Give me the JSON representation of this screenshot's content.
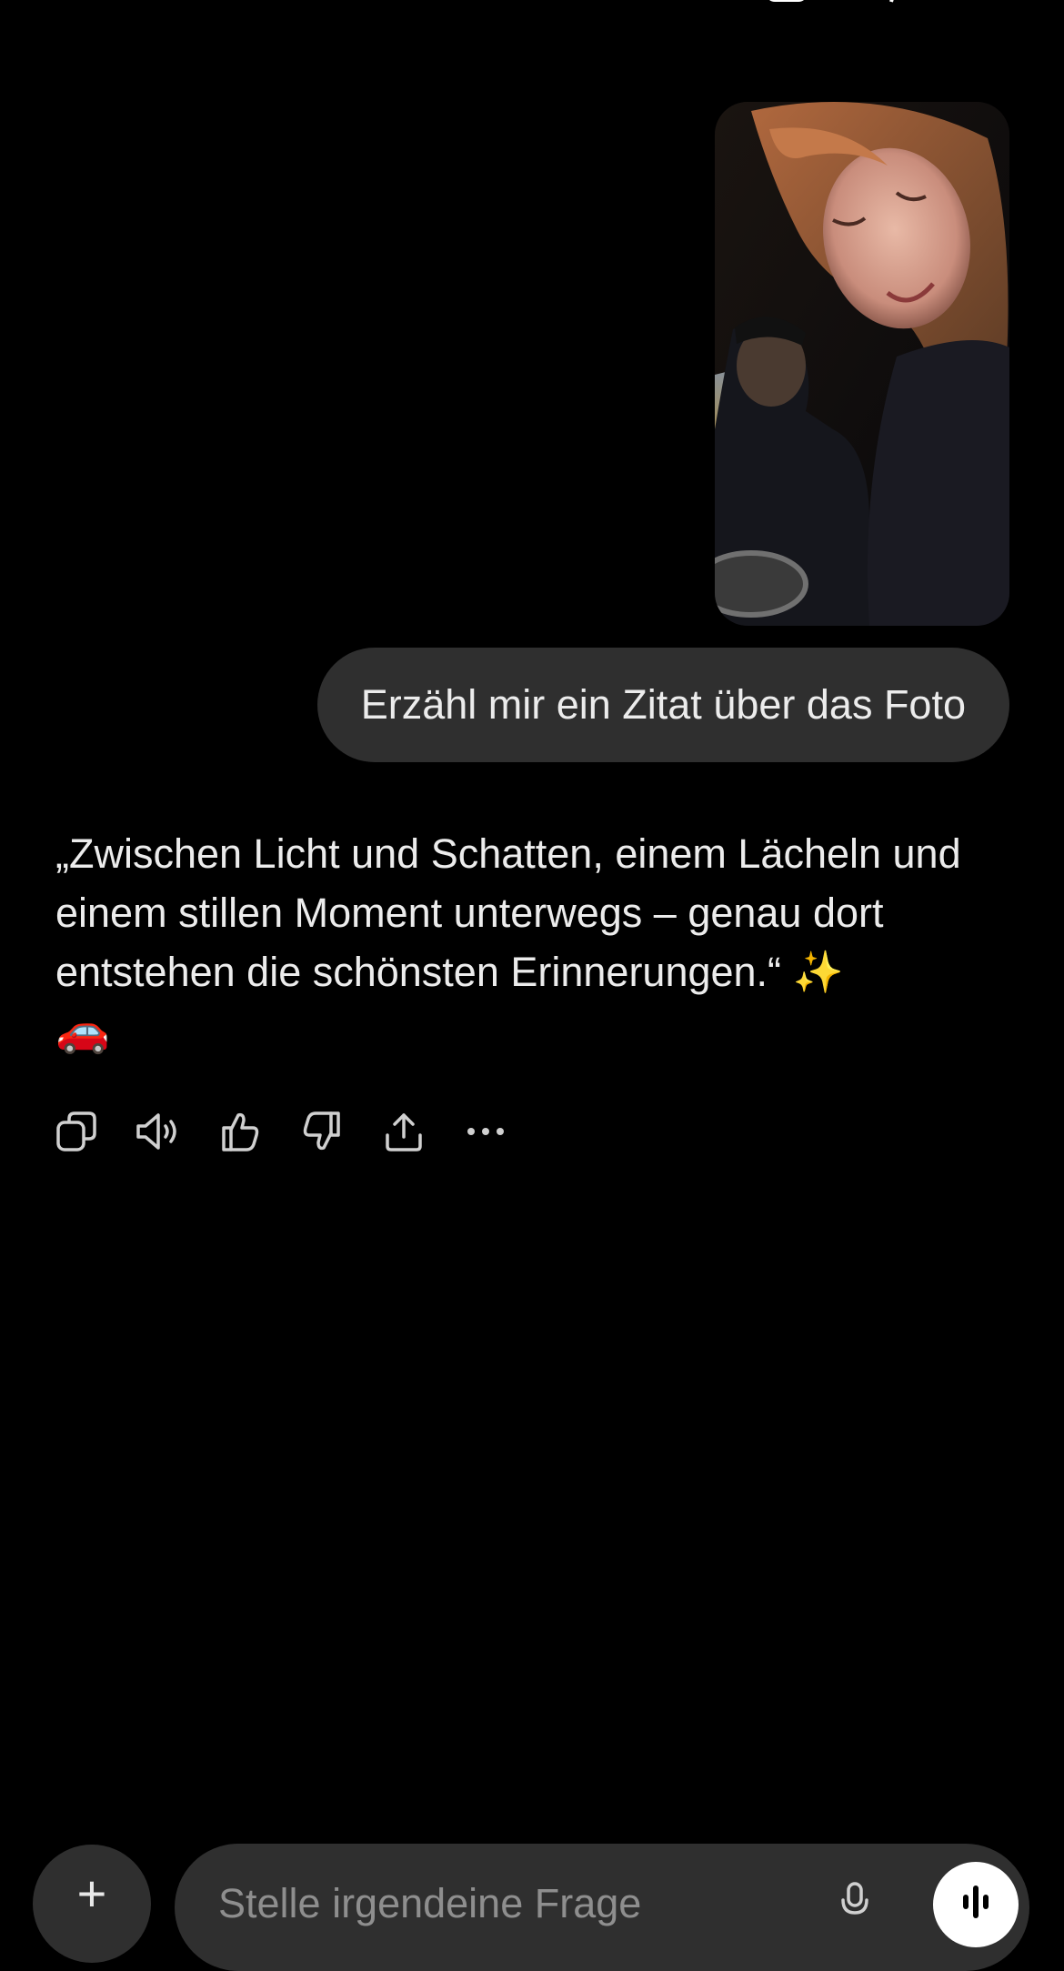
{
  "conversation": {
    "user_image_alt": "",
    "user_message": "Erzähl mir ein Zitat über das Foto",
    "assistant_message": "„Zwischen Licht und Schatten, einem Lächeln und einem stillen Moment unterwegs – genau dort entstehen die schönsten Erinnerungen.“ ✨",
    "assistant_emoji": "🚗"
  },
  "actions": [
    {
      "name": "copy-icon"
    },
    {
      "name": "read-aloud-icon"
    },
    {
      "name": "thumbs-up-icon"
    },
    {
      "name": "thumbs-down-icon"
    },
    {
      "name": "share-icon"
    },
    {
      "name": "more-icon"
    }
  ],
  "composer": {
    "placeholder": "Stelle irgendeine Frage",
    "plus_label": "+"
  },
  "colors": {
    "background": "#000000",
    "bubble": "#2f2f2f",
    "text": "#ececec",
    "placeholder": "#8e8e8e"
  }
}
